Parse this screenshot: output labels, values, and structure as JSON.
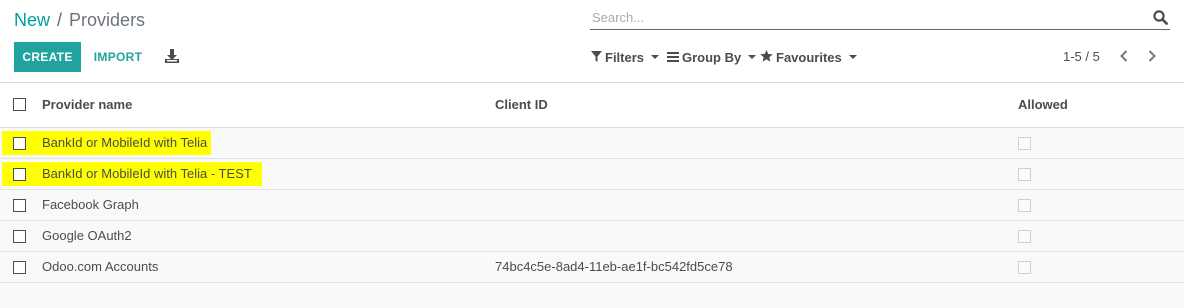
{
  "breadcrumb": {
    "parent": "New",
    "separator": "/",
    "current": "Providers"
  },
  "search": {
    "placeholder": "Search...",
    "value": ""
  },
  "buttons": {
    "create": "CREATE",
    "import": "IMPORT"
  },
  "filters": {
    "filters": "Filters",
    "group_by": "Group By",
    "favourites": "Favourites"
  },
  "pager": {
    "value": "1-5 / 5"
  },
  "table": {
    "headers": {
      "name": "Provider name",
      "client_id": "Client ID",
      "allowed": "Allowed"
    },
    "rows": [
      {
        "name": "BankId or MobileId with Telia",
        "client_id": "",
        "allowed": false,
        "highlighted": true
      },
      {
        "name": "BankId or MobileId with Telia - TEST",
        "client_id": "",
        "allowed": false,
        "highlighted": true
      },
      {
        "name": "Facebook Graph",
        "client_id": "",
        "allowed": false,
        "highlighted": false
      },
      {
        "name": "Google OAuth2",
        "client_id": "",
        "allowed": false,
        "highlighted": false
      },
      {
        "name": "Odoo.com Accounts",
        "client_id": "74bc4c5e-8ad4-11eb-ae1f-bc542fd5ce78",
        "allowed": false,
        "highlighted": false
      }
    ]
  },
  "colors": {
    "accent": "#21a39f",
    "highlight": "#ffff00",
    "text": "#4c4c4c"
  },
  "icons": [
    "search-icon",
    "download-icon",
    "filter-icon",
    "list-icon",
    "star-icon",
    "chevron-left-icon",
    "chevron-right-icon"
  ]
}
